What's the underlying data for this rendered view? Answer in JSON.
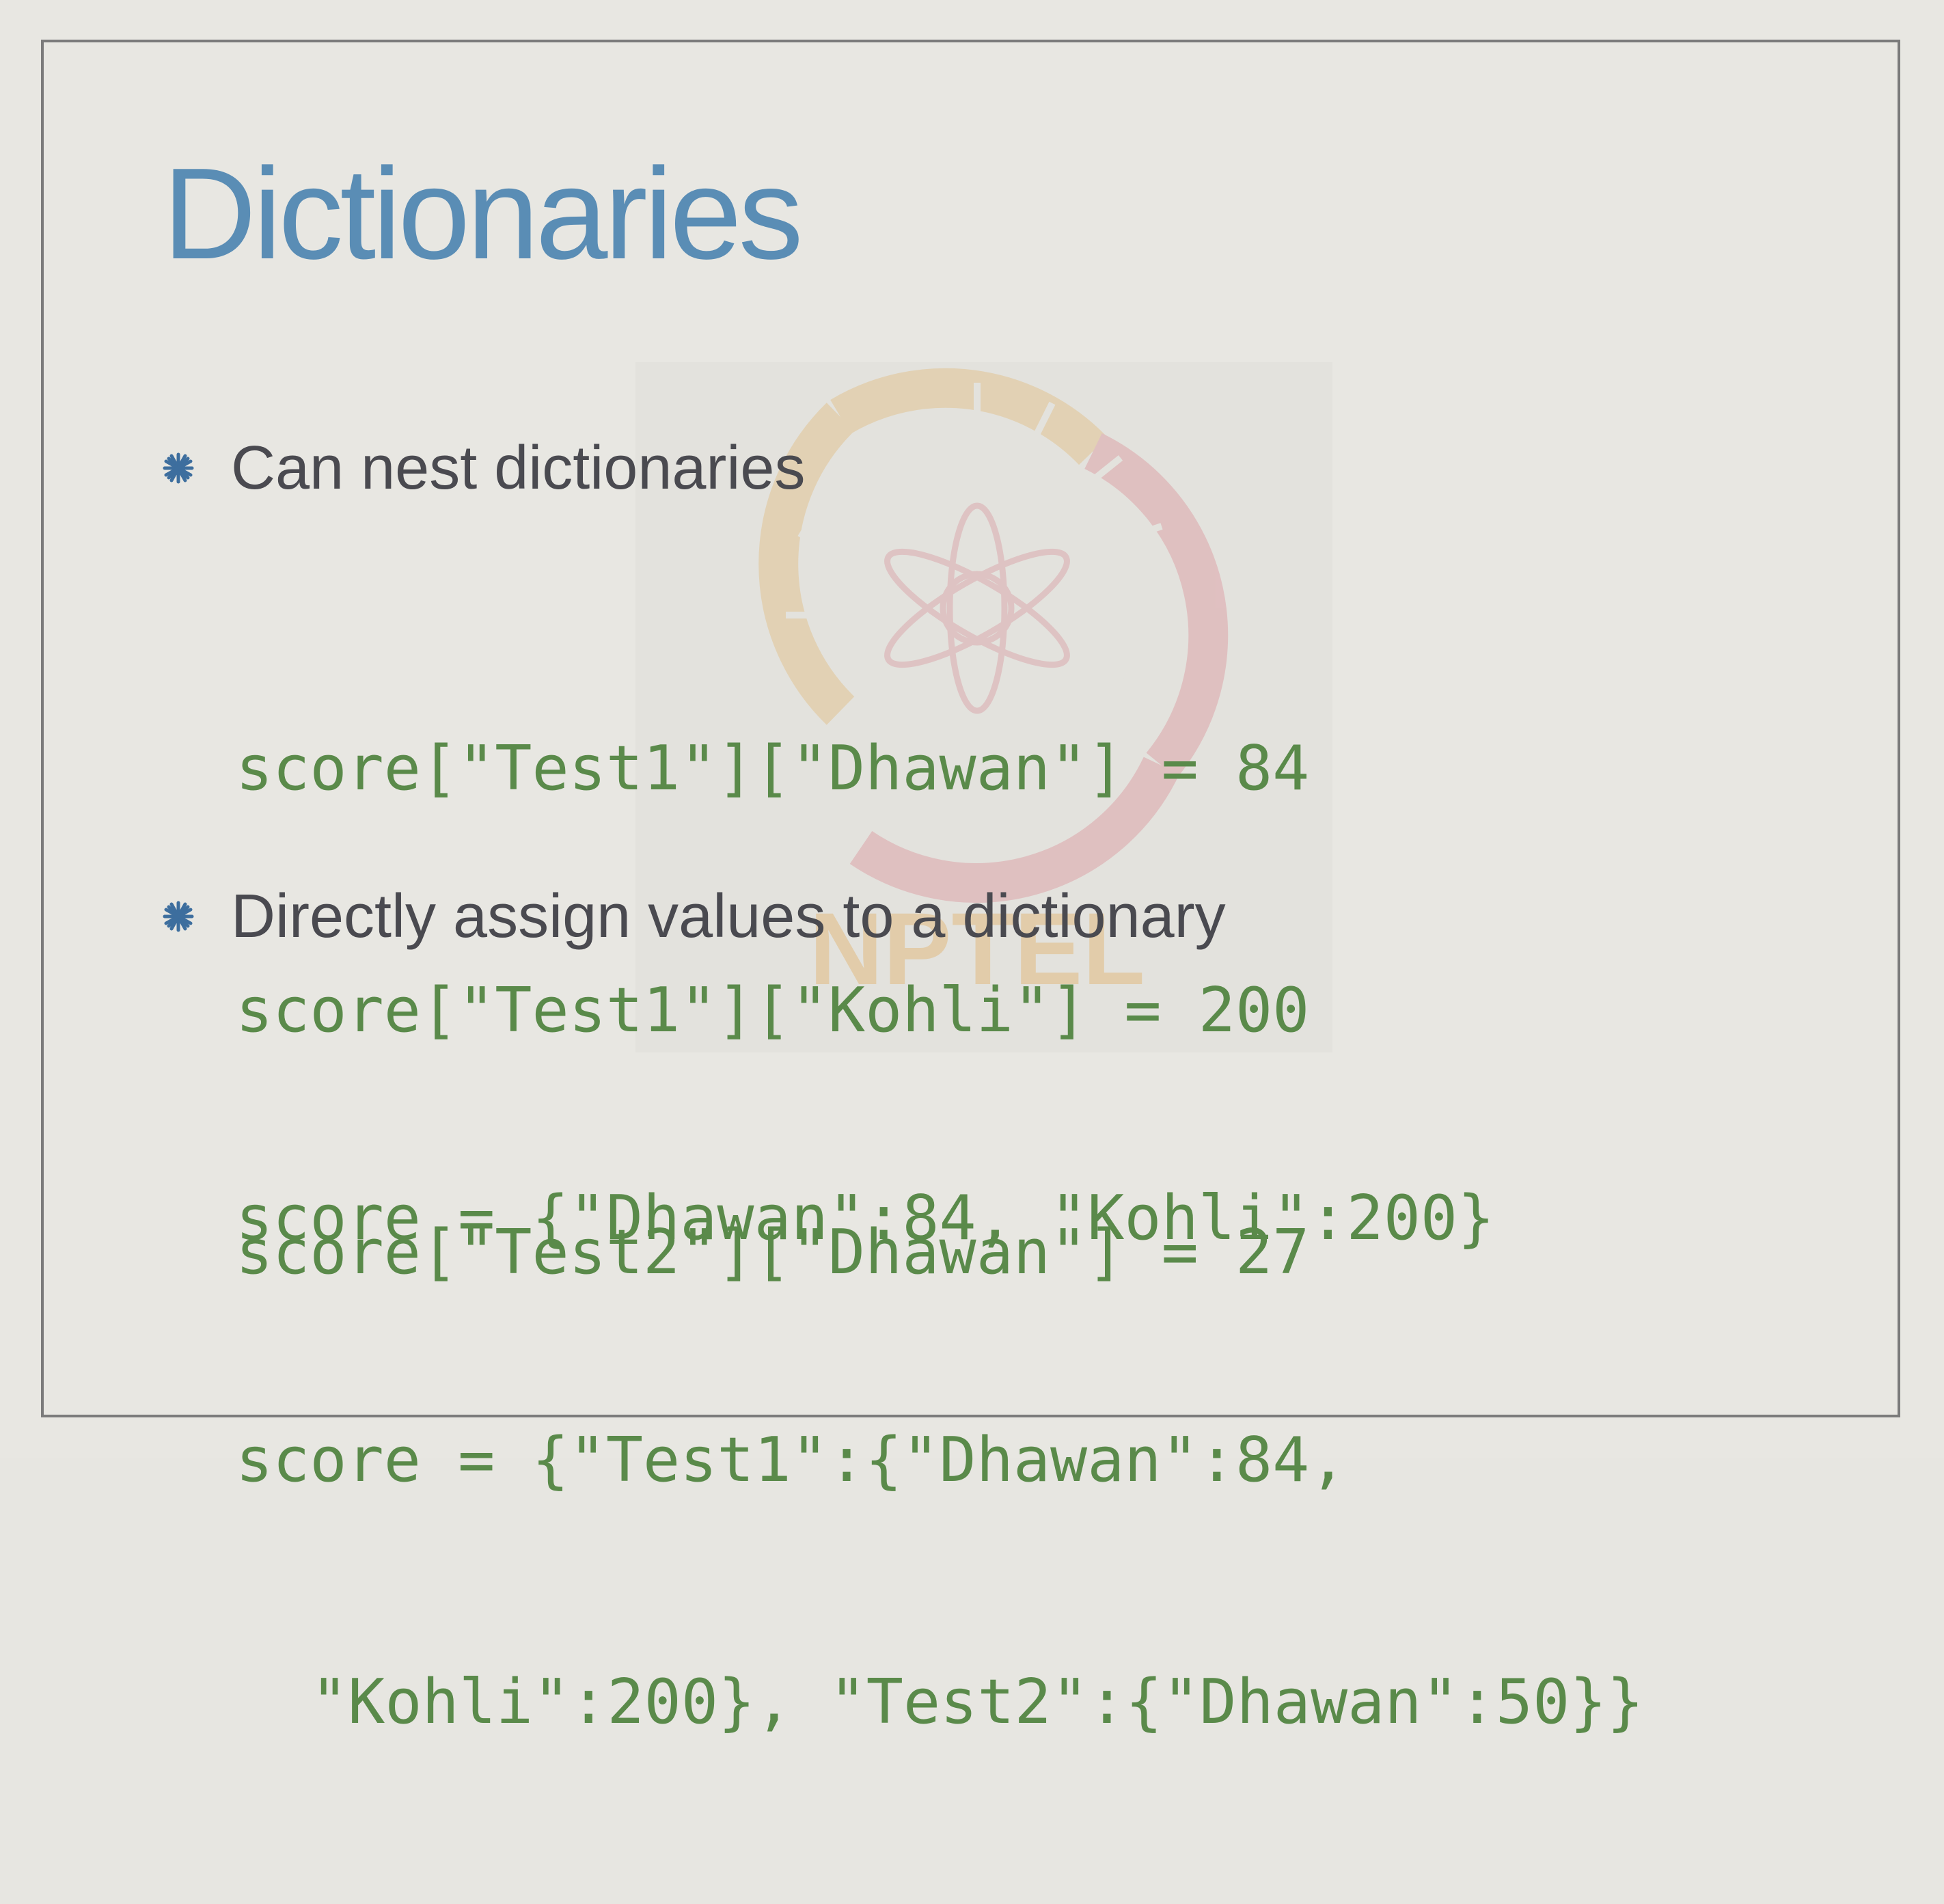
{
  "slide": {
    "title": "Dictionaries",
    "bullets": [
      {
        "text": "Can nest dictionaries",
        "code": [
          "score[\"Test1\"][\"Dhawan\"] = 84",
          "score[\"Test1\"][\"Kohli\"] = 200",
          "score[\"Test2\"][\"Dhawan\"] = 27"
        ]
      },
      {
        "text": "Directly assign values to a dictionary",
        "code": [
          "score = {\"Dhawan\":84, \"Kohli\":200}",
          "score = {\"Test1\":{\"Dhawan\":84,",
          "\"Kohli\":200}, \"Test2\":{\"Dhawan\":50}}"
        ]
      }
    ],
    "watermark_text": "NPTEL",
    "colors": {
      "title": "#5a8db5",
      "body": "#4a4a50",
      "code": "#5a8a4a",
      "bullet_icon": "#3d6e9e",
      "frame": "#7b7b7b"
    },
    "bullet_icon": "asterisk-icon"
  }
}
